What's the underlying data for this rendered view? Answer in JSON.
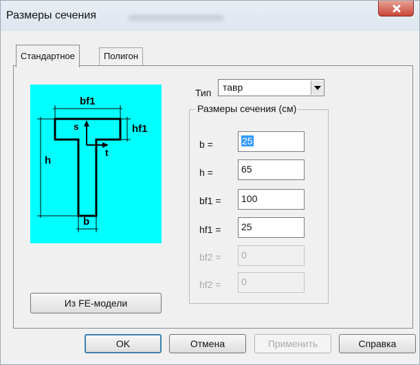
{
  "window": {
    "title": "Размеры сечения"
  },
  "tabs": [
    {
      "label": "Стандартное",
      "active": true
    },
    {
      "label": "Полигон",
      "active": false
    }
  ],
  "diagram": {
    "background": "#00ffff",
    "labels": {
      "bf1": "bf1",
      "hf1": "hf1",
      "h": "h",
      "b": "b",
      "s": "s",
      "t": "t"
    }
  },
  "type": {
    "label": "Тип",
    "value": "тавр"
  },
  "group": {
    "legend": "Размеры сечения (см)",
    "fields": [
      {
        "label": "b =",
        "value": "25",
        "enabled": true
      },
      {
        "label": "h =",
        "value": "65",
        "enabled": true
      },
      {
        "label": "bf1 =",
        "value": "100",
        "enabled": true
      },
      {
        "label": "hf1 =",
        "value": "25",
        "enabled": true
      },
      {
        "label": "bf2 =",
        "value": "0",
        "enabled": false
      },
      {
        "label": "hf2 =",
        "value": "0",
        "enabled": false
      }
    ]
  },
  "buttons": {
    "from_fe": "Из FE-модели",
    "ok": "OK",
    "cancel": "Отмена",
    "apply": "Применить",
    "help": "Справка"
  }
}
